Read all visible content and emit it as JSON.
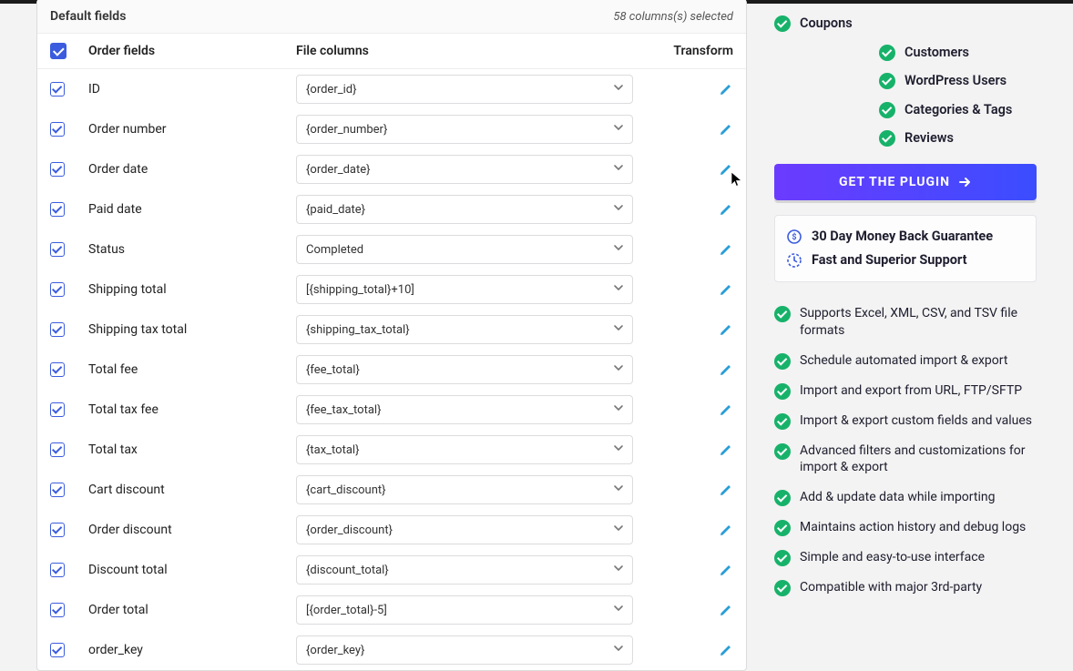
{
  "panel": {
    "title": "Default fields",
    "selected_text": "58 columns(s) selected",
    "headers": {
      "check": "",
      "field": "Order fields",
      "file": "File columns",
      "transform": "Transform"
    }
  },
  "rows": [
    {
      "field": "ID",
      "file": "{order_id}"
    },
    {
      "field": "Order number",
      "file": "{order_number}"
    },
    {
      "field": "Order date",
      "file": "{order_date}"
    },
    {
      "field": "Paid date",
      "file": "{paid_date}"
    },
    {
      "field": "Status",
      "file": "Completed"
    },
    {
      "field": "Shipping total",
      "file": "[{shipping_total}+10]"
    },
    {
      "field": "Shipping tax total",
      "file": "{shipping_tax_total}"
    },
    {
      "field": "Total fee",
      "file": "{fee_total}"
    },
    {
      "field": "Total tax fee",
      "file": "{fee_tax_total}"
    },
    {
      "field": "Total tax",
      "file": "{tax_total}"
    },
    {
      "field": "Cart discount",
      "file": "{cart_discount}"
    },
    {
      "field": "Order discount",
      "file": "{order_discount}"
    },
    {
      "field": "Discount total",
      "file": "{discount_total}"
    },
    {
      "field": "Order total",
      "file": "[{order_total}-5]"
    },
    {
      "field": "order_key",
      "file": "{order_key}"
    }
  ],
  "sidebar": {
    "top_items": [
      "Coupons"
    ],
    "indented_items": [
      "Customers",
      "WordPress Users",
      "Categories & Tags",
      "Reviews"
    ],
    "cta_label": "GET THE PLUGIN",
    "guarantee": "30 Day Money Back Guarantee",
    "support": "Fast and Superior Support",
    "features": [
      "Supports Excel, XML, CSV, and TSV file formats",
      "Schedule automated import & export",
      "Import and export from URL, FTP/SFTP",
      "Import & export custom fields and values",
      "Advanced filters and customizations for import & export",
      "Add & update data while importing",
      "Maintains action history and debug logs",
      "Simple and easy-to-use interface",
      "Compatible with major 3rd-party"
    ]
  }
}
